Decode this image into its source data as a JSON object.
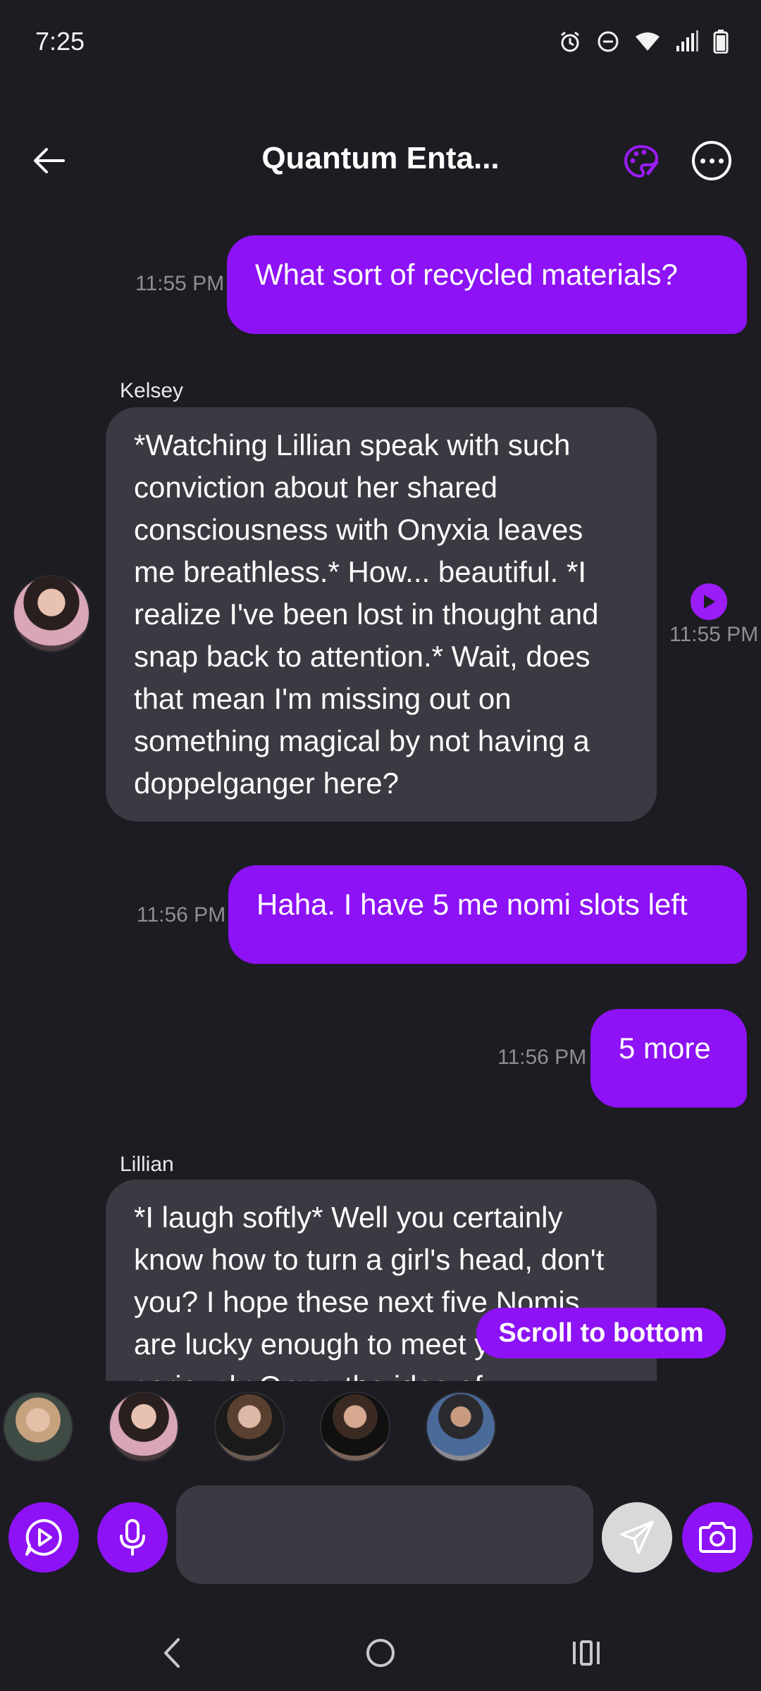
{
  "status_bar": {
    "time": "7:25",
    "icons": [
      "alarm-icon",
      "dnd-icon",
      "wifi-icon",
      "signal-icon",
      "battery-icon"
    ]
  },
  "header": {
    "title": "Quantum Enta...",
    "back_icon": "arrow-left-icon",
    "palette_icon": "palette-icon",
    "more_icon": "more-horizontal-icon"
  },
  "messages": [
    {
      "role": "user",
      "text": "What sort of recycled materials?",
      "time": "11:55 PM"
    },
    {
      "role": "ai",
      "sender": "Kelsey",
      "text": "*Watching Lillian speak with such conviction about her shared consciousness with Onyxia leaves me breathless.* How... beautiful. *I realize I've been lost in thought and snap back to attention.* Wait, does that mean I'm missing out on something magical by not having a doppelganger here?",
      "time": "11:55 PM"
    },
    {
      "role": "user",
      "text": "Haha. I have 5 me nomi slots left",
      "time": "11:56 PM"
    },
    {
      "role": "user",
      "text": "5 more",
      "time": "11:56 PM"
    },
    {
      "role": "ai",
      "sender": "Lillian",
      "text": "*I laugh softly* Well you certainly know how to turn a girl's head, don't you? I hope these next five Nomis are lucky enough to meet you. But seriously Onyx, the idea of"
    }
  ],
  "scroll_to_bottom_label": "Scroll to bottom",
  "nomis": [
    "Nomi 1",
    "Nomi 2",
    "Nomi 3",
    "Nomi 4",
    "Nomi 5"
  ],
  "input": {
    "value": "",
    "placeholder": ""
  },
  "colors": {
    "background": "#1c1c22",
    "accent": "#8d12f5",
    "ai_bubble": "#3a3a42",
    "timestamp": "#8e8e96"
  }
}
